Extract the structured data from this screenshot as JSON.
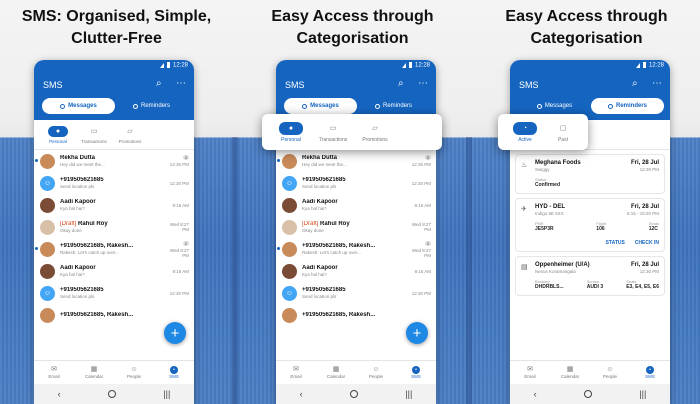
{
  "captions": [
    "SMS: Organised, Simple, Clutter-Free",
    "Easy Access through Categorisation",
    "Easy Access through Categorisation"
  ],
  "app": {
    "title": "SMS",
    "time": "12:28",
    "seg_messages": "Messages",
    "seg_reminders": "Reminders",
    "categories": [
      "Personal",
      "Transactions",
      "Promotions"
    ],
    "reminder_categories": [
      "Active",
      "Past"
    ],
    "tabs": [
      "Email",
      "Calendar",
      "People",
      "SMS"
    ]
  },
  "messages": [
    {
      "name": "Rekha Dutta",
      "snippet": "Hey did we meet the...",
      "time": "12:36 PM",
      "count": "3",
      "unread": true,
      "avatar": "p1",
      "draft": ""
    },
    {
      "name": "+919505621685",
      "snippet": "Send location pls",
      "time": "12:30 PM",
      "count": "",
      "unread": false,
      "avatar": "gen",
      "draft": ""
    },
    {
      "name": "Aadi Kapoor",
      "snippet": "Kya hal hai?",
      "time": "9:16 AM",
      "count": "",
      "unread": false,
      "avatar": "p2",
      "draft": ""
    },
    {
      "name": "Rahul Roy",
      "snippet": "Okay done",
      "time": "Wed 8:27 PM",
      "count": "",
      "unread": false,
      "avatar": "p3",
      "draft": "[Draft]"
    },
    {
      "name": "+919505621685, Rakesh...",
      "snippet": "Rakesh: Let's catch up over...",
      "time": "Wed 8:27 PM",
      "count": "2",
      "unread": true,
      "avatar": "p1",
      "draft": ""
    },
    {
      "name": "Aadi Kapoor",
      "snippet": "Kya hal hai?",
      "time": "9:16 AM",
      "count": "",
      "unread": false,
      "avatar": "p2",
      "draft": ""
    },
    {
      "name": "+919505621685",
      "snippet": "Send location pls",
      "time": "12:30 PM",
      "count": "",
      "unread": false,
      "avatar": "gen",
      "draft": ""
    },
    {
      "name": "+919505621685, Rakesh...",
      "snippet": "",
      "time": "",
      "count": "",
      "unread": false,
      "avatar": "p1",
      "draft": ""
    }
  ],
  "reminders": {
    "card1": {
      "title": "Meghana Foods",
      "date": "Fri, 28 Jul",
      "sub": "Swiggy",
      "time": "12:30 PM",
      "status_label": "Status",
      "status": "Confirmed"
    },
    "card2": {
      "title": "HYD - DEL",
      "date": "Fri, 28 Jul",
      "sub": "Indigo 6E 6XX",
      "time": "6:15 - 10:20 PM",
      "cols": [
        {
          "label": "PNR",
          "value": "JE5P3R"
        },
        {
          "label": "Flight",
          "value": "106"
        },
        {
          "label": "Seats",
          "value": "12C"
        }
      ],
      "action1": "STATUS",
      "action2": "CHECK IN"
    },
    "card3": {
      "title": "Oppenheimer (U/A)",
      "date": "Fri, 28 Jul",
      "sub": "Nexus Koramangala",
      "time": "12:30 PM",
      "cols": [
        {
          "label": "Booking",
          "value": "DHDRBLS..."
        },
        {
          "label": "Screen",
          "value": "AUDI 3"
        },
        {
          "label": "Seats",
          "value": "E3, E4, E5, E6"
        }
      ]
    }
  }
}
